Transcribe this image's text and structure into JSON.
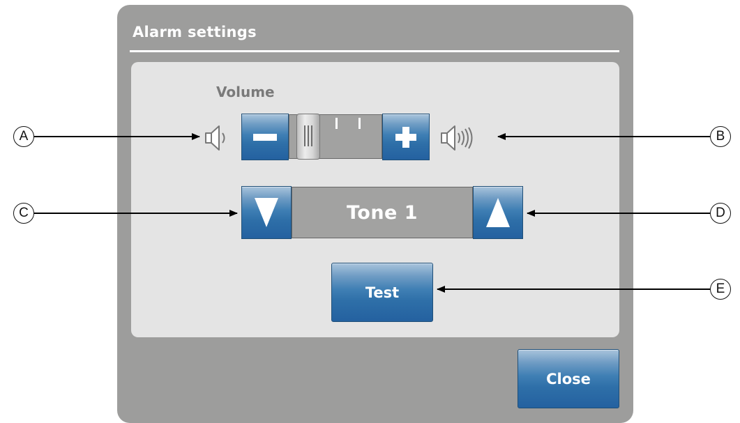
{
  "dialog": {
    "title": "Alarm settings",
    "volume": {
      "label": "Volume",
      "decrease_symbol": "−",
      "increase_symbol": "+",
      "level_fraction": 0.1
    },
    "tone": {
      "value": "Tone 1"
    },
    "test_button": "Test",
    "close_button": "Close"
  },
  "callouts": [
    "A",
    "B",
    "C",
    "D",
    "E"
  ],
  "colors": {
    "dialog_bg": "#9d9d9c",
    "panel_bg": "#e4e4e4",
    "button_blue": "#2e6fa8",
    "display_gray": "#a2a2a1"
  },
  "icons": [
    "speaker-quiet-icon",
    "speaker-loud-icon",
    "triangle-down-icon",
    "triangle-up-icon"
  ]
}
